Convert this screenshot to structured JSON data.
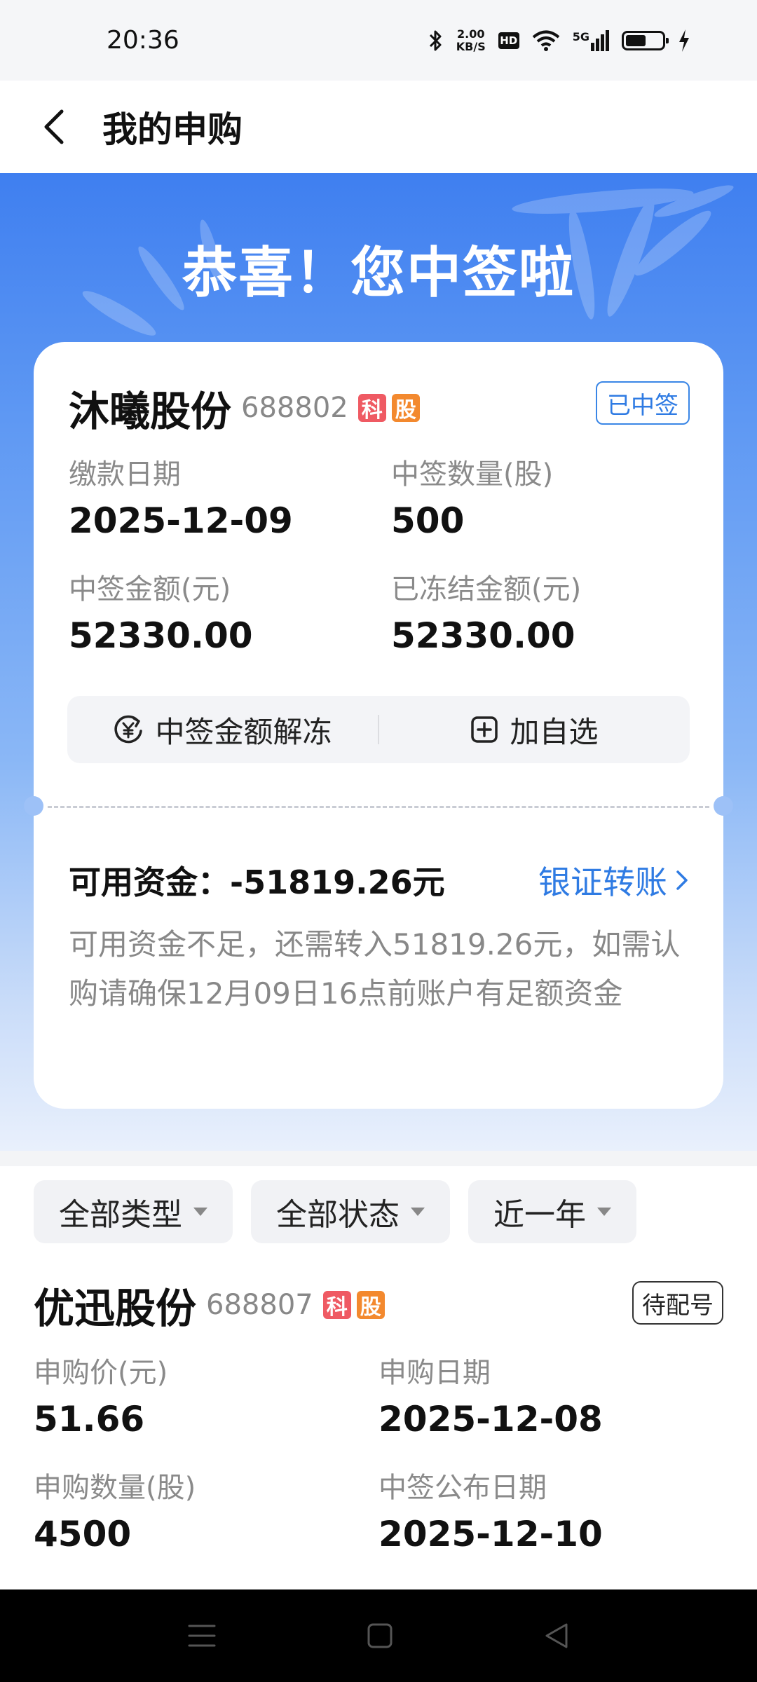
{
  "status_bar": {
    "time": "20:36",
    "net_speed_value": "2.00",
    "net_speed_unit": "KB/S",
    "hd_label": "HD",
    "network_label": "5G",
    "icons": [
      "bluetooth-icon",
      "wifi-icon",
      "signal-icon",
      "battery-icon",
      "charging-icon"
    ]
  },
  "header": {
    "title": "我的申购"
  },
  "hero": {
    "title": "恭喜！您中签啦",
    "accent_color": "#3f7ff0"
  },
  "win_card": {
    "stock_name": "沐曦股份",
    "stock_code": "688802",
    "tag_ke": "科",
    "tag_gu": "股",
    "status": "已中签",
    "fields": [
      {
        "label": "缴款日期",
        "value": "2025-12-09"
      },
      {
        "label": "中签数量(股)",
        "value": "500"
      },
      {
        "label": "中签金额(元)",
        "value": "52330.00"
      },
      {
        "label": "已冻结金额(元)",
        "value": "52330.00"
      }
    ],
    "actions": {
      "unfreeze_label": "中签金额解冻",
      "add_watchlist_label": "加自选"
    },
    "available_funds": "可用资金：-51819.26元",
    "transfer_label": "银证转账",
    "note": "可用资金不足，还需转入51819.26元，如需认购请确保12月09日16点前账户有足额资金"
  },
  "filters": {
    "type": "全部类型",
    "status": "全部状态",
    "period": "近一年"
  },
  "listing": {
    "stock_name": "优迅股份",
    "stock_code": "688807",
    "tag_ke": "科",
    "tag_gu": "股",
    "status": "待配号",
    "fields": [
      {
        "label": "申购价(元)",
        "value": "51.66"
      },
      {
        "label": "申购日期",
        "value": "2025-12-08"
      },
      {
        "label": "申购数量(股)",
        "value": "4500"
      },
      {
        "label": "中签公布日期",
        "value": "2025-12-10"
      }
    ]
  },
  "colors": {
    "link_blue": "#2f7be3",
    "tag_red": "#ef5a63",
    "tag_orange": "#f3892e"
  }
}
